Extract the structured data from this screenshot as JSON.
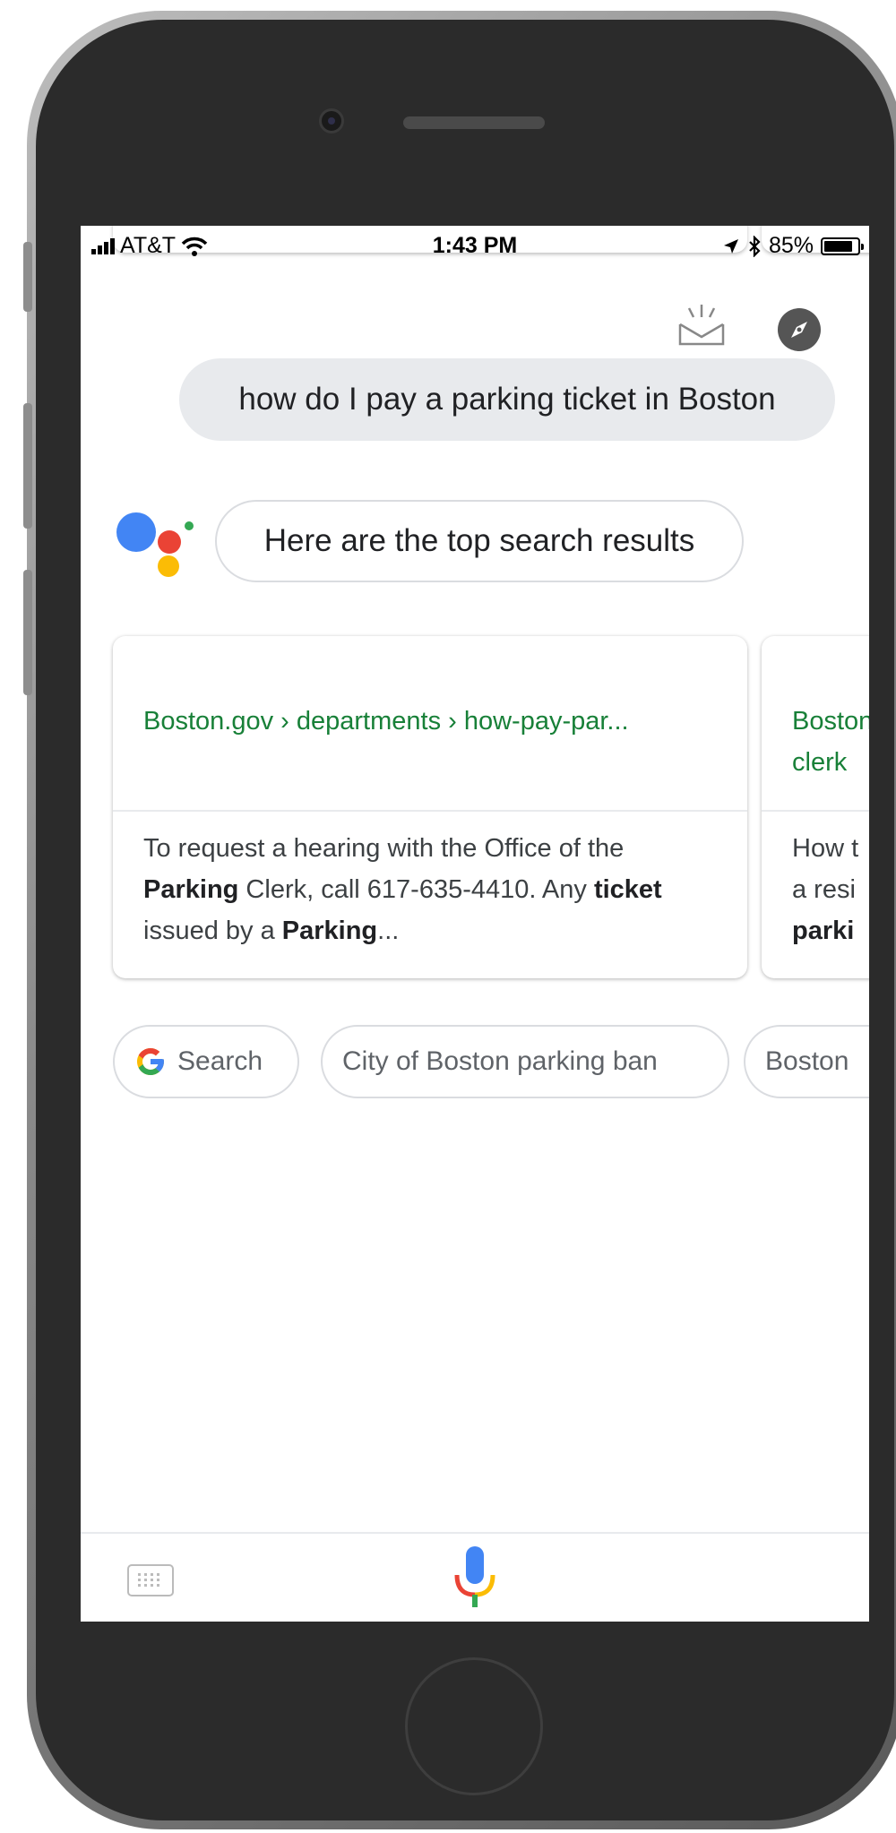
{
  "status_bar": {
    "carrier": "AT&T",
    "time": "1:43 PM",
    "battery": "85%",
    "battery_level": 0.85
  },
  "query": "how do I pay a parking ticket in Boston",
  "assistant_reply": "Here are the top search results",
  "results": [
    {
      "url": "Boston.gov › departments › how-pay-par...",
      "snippet_parts": [
        {
          "t": "To request a hearing with the Office of the ",
          "b": false
        },
        {
          "t": "Parking",
          "b": true
        },
        {
          "t": " Clerk, call 617-635-4410. Any ",
          "b": false
        },
        {
          "t": "ticket",
          "b": true
        },
        {
          "t": " issued by a ",
          "b": false
        },
        {
          "t": "Parking",
          "b": true
        },
        {
          "t": "...",
          "b": false
        }
      ]
    },
    {
      "url": "Boston",
      "url_line2": "clerk",
      "snippet_lines": [
        "How t",
        "a resi",
        "parki"
      ]
    }
  ],
  "chips": {
    "search": "Search",
    "chip1": "City of Boston parking ban",
    "chip2": "Boston"
  },
  "colors": {
    "google_blue": "#4285F4",
    "google_red": "#EA4335",
    "google_yellow": "#FBBC05",
    "google_green": "#34A853",
    "url_green": "#188038"
  },
  "icons": [
    "signal-icon",
    "wifi-icon",
    "location-arrow-icon",
    "bluetooth-icon",
    "battery-icon",
    "share-icon",
    "explore-icon",
    "assistant-logo",
    "google-g-icon",
    "keyboard-icon",
    "mic-icon"
  ]
}
